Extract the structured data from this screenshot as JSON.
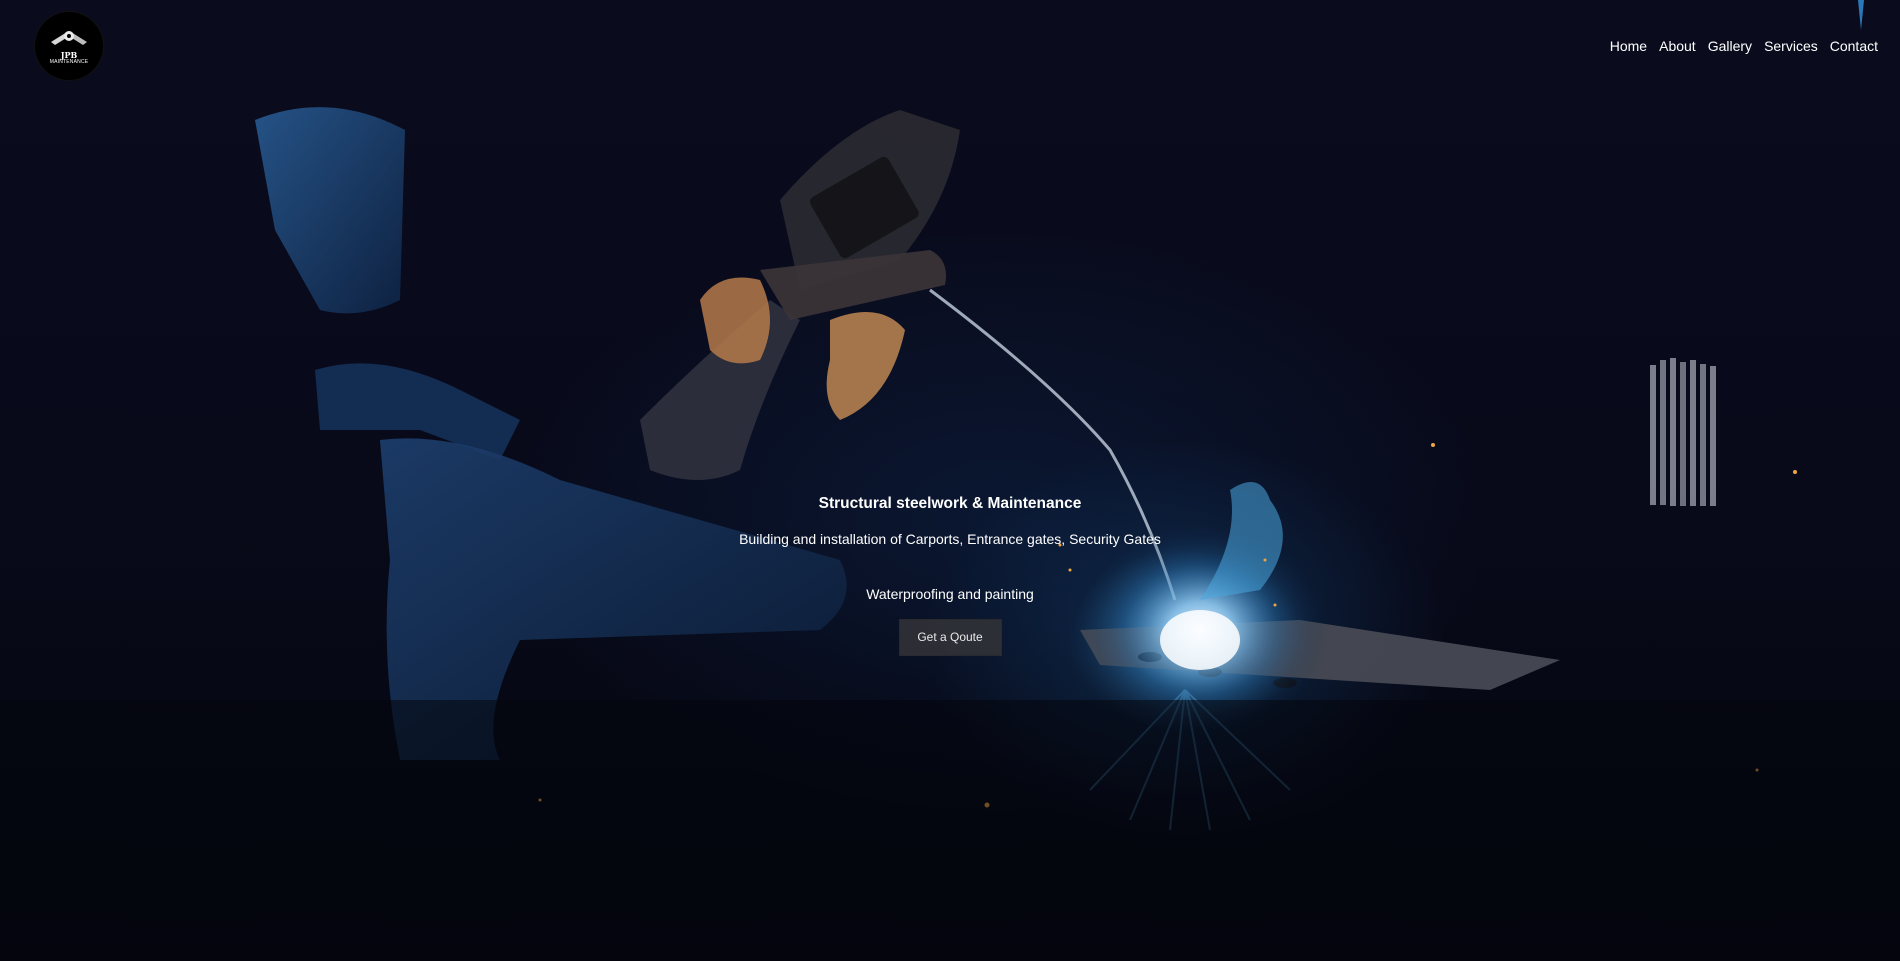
{
  "brand": {
    "logo_text": "JPB",
    "logo_subtext": "MAINTENANCE"
  },
  "nav": {
    "items": [
      {
        "label": "Home"
      },
      {
        "label": "About"
      },
      {
        "label": "Gallery"
      },
      {
        "label": "Services"
      },
      {
        "label": "Contact"
      }
    ]
  },
  "hero": {
    "headline": "Structural steelwork & Maintenance",
    "subline": "Building and installation of Carports, Entrance gates, Security Gates",
    "subline2": "Waterproofing and painting",
    "cta_label": "Get a Qoute"
  },
  "colors": {
    "background": "#05060e",
    "text": "#ffffff",
    "button_bg": "#343438",
    "weld_glow": "#3c96d2"
  }
}
